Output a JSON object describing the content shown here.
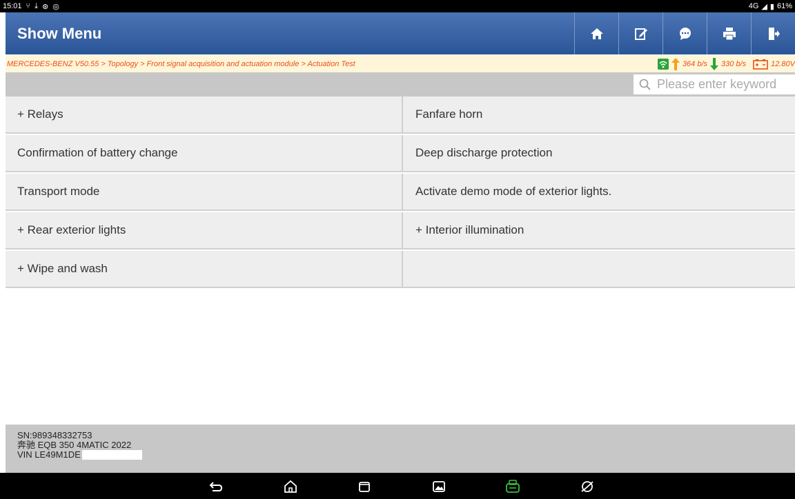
{
  "status": {
    "time": "15:01",
    "net": "4G",
    "battery": "61%"
  },
  "header": {
    "title": "Show Menu",
    "buttons": [
      "home-icon",
      "edit-icon",
      "message-icon",
      "print-icon",
      "exit-icon"
    ]
  },
  "breadcrumb": {
    "path": "MERCEDES-BENZ V50.55 > Topology > Front signal acquisition and actuation module > Actuation Test",
    "upload": "364 b/s",
    "download": "330 b/s",
    "voltage": "12.80V"
  },
  "search": {
    "placeholder": "Please enter keyword"
  },
  "menu": {
    "items": [
      "+ Relays",
      "Fanfare horn",
      "Confirmation of battery change",
      "Deep discharge protection",
      "Transport mode",
      "Activate demo mode of exterior lights.",
      "+ Rear exterior lights",
      "+ Interior illumination",
      "+ Wipe and wash",
      ""
    ]
  },
  "footer": {
    "sn": "SN:989348332753",
    "vehicle": "奔驰 EQB 350 4MATIC 2022",
    "vin": "VIN LE49M1DE"
  },
  "colors": {
    "header": "#2f5b9e",
    "breadcrumb_bg": "#fff6d9",
    "breadcrumb_text": "#e94e1a",
    "cell_bg": "#eeeeee",
    "toolbar_gray": "#c7c7c7"
  }
}
